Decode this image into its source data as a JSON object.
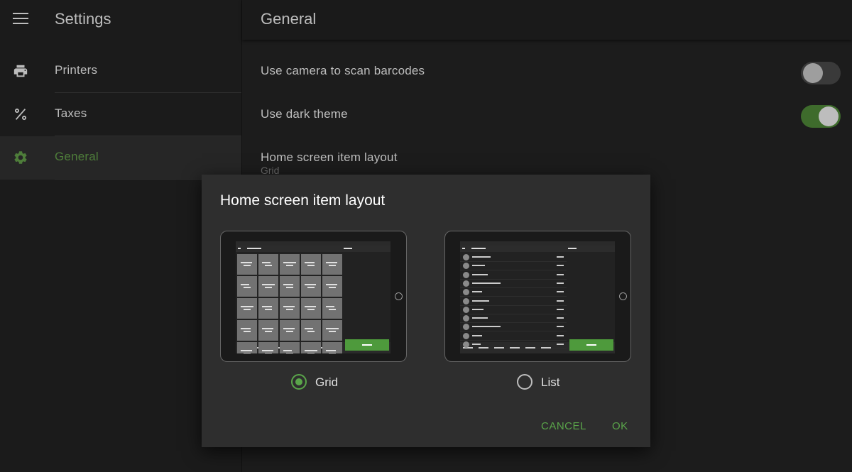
{
  "left_pane": {
    "title": "Settings",
    "menu_icon": "hamburger-menu-icon",
    "items": [
      {
        "label": "Printers",
        "icon": "printer-icon",
        "active": false
      },
      {
        "label": "Taxes",
        "icon": "percent-icon",
        "active": false
      },
      {
        "label": "General",
        "icon": "gear-icon",
        "active": true
      }
    ]
  },
  "right_pane": {
    "title": "General",
    "prefs": [
      {
        "label": "Use camera to scan barcodes",
        "toggle": false
      },
      {
        "label": "Use dark theme",
        "toggle": true
      },
      {
        "label": "Home screen item layout",
        "summary": "Grid"
      }
    ]
  },
  "dialog": {
    "title": "Home screen item layout",
    "options": [
      {
        "label": "Grid",
        "selected": true,
        "preview": "grid-preview"
      },
      {
        "label": "List",
        "selected": false,
        "preview": "list-preview"
      }
    ],
    "cancel_label": "CANCEL",
    "ok_label": "OK"
  },
  "colors": {
    "accent": "#5aa54a",
    "background": "#1a1a1a",
    "dialog": "#2e2e2e",
    "active_nav_text": "#4e7d3a"
  }
}
